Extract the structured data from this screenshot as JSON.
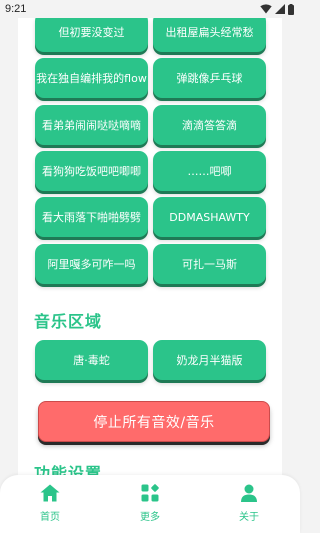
{
  "status_bar": {
    "time": "9:21"
  },
  "top_partial_buttons": [
    "",
    ""
  ],
  "sound_effects": [
    "但初要没变过",
    "出租屋扁头经常愁",
    "我在独自编排我的flow",
    "弹跳像乒乓球",
    "看弟弟闹闹哒哒嘀嘀",
    "滴滴答答滴",
    "看狗狗吃饭吧吧唧唧",
    "……吧唧",
    "看大雨落下啪啪劈劈",
    "DDMASHAWTY",
    "阿里嘎多可咋一吗",
    "可扎一马斯"
  ],
  "music_section": {
    "title": "音乐区域",
    "items": [
      "唐·毒蛇",
      "奶龙月半猫版"
    ]
  },
  "stop_button": {
    "label": "停止所有音效/音乐"
  },
  "settings_section": {
    "title": "功能设置"
  },
  "bottom_nav": {
    "items": [
      {
        "label": "首页",
        "icon": "home-icon"
      },
      {
        "label": "更多",
        "icon": "apps-icon"
      },
      {
        "label": "关于",
        "icon": "person-icon"
      }
    ]
  },
  "colors": {
    "accent": "#2bc48a",
    "stop_button": "#ff6b6b",
    "background": "#f3f3f3"
  }
}
